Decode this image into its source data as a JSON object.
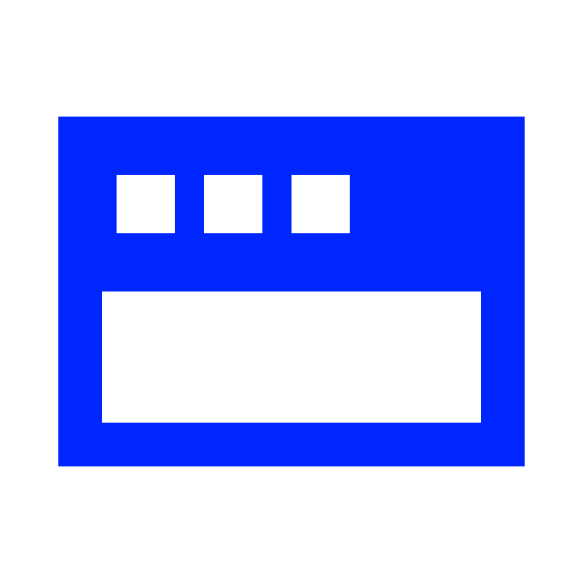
{
  "icon": {
    "name": "browser-window-icon",
    "color": "#0026ff",
    "background": "#ffffff"
  }
}
